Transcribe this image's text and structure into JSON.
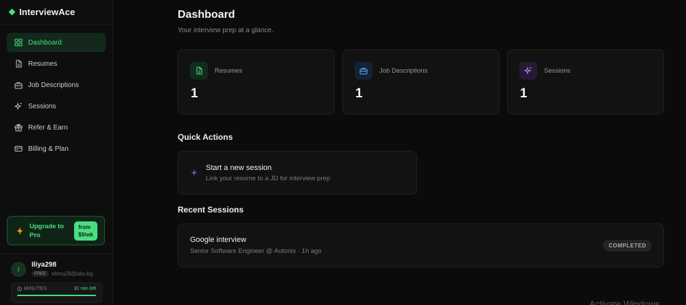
{
  "brand": {
    "name": "InterviewAce"
  },
  "sidebar": {
    "items": [
      {
        "label": "Dashboard",
        "icon": "grid-icon",
        "active": true
      },
      {
        "label": "Resumes",
        "icon": "file-icon"
      },
      {
        "label": "Job Descriptions",
        "icon": "briefcase-icon"
      },
      {
        "label": "Sessions",
        "icon": "sparkles-icon"
      },
      {
        "label": "Refer & Earn",
        "icon": "gift-icon"
      },
      {
        "label": "Billing & Plan",
        "icon": "credit-card-icon"
      }
    ],
    "upgrade": {
      "label": "Upgrade to Pro",
      "price_line1": "from",
      "price_line2": "$9/wk"
    }
  },
  "user": {
    "initial": "I",
    "name": "Iliya298",
    "plan": "FREE",
    "email": "shmu28@abv.bg",
    "minutes_label": "MINUTES",
    "minutes_left": "31 min left",
    "minutes_fraction": 1.0
  },
  "main": {
    "title": "Dashboard",
    "subtitle": "Your interview prep at a glance.",
    "stats": [
      {
        "label": "Resumes",
        "value": "1",
        "icon": "file-icon",
        "color": "#4ade80"
      },
      {
        "label": "Job Descriptions",
        "value": "1",
        "icon": "briefcase-icon",
        "color": "#60a5fa"
      },
      {
        "label": "Sessions",
        "value": "1",
        "icon": "sparkles-icon",
        "color": "#c084fc"
      }
    ],
    "quick_actions_title": "Quick Actions",
    "quick_action": {
      "title": "Start a new session",
      "subtitle": "Link your resume to a JD for interview prep"
    },
    "recent_sessions_title": "Recent Sessions",
    "session": {
      "title": "Google interview",
      "subtitle": "Senior Software Engineer @ Autonix · 1h ago",
      "status": "COMPLETED"
    }
  },
  "watermark": "Activate Windows",
  "colors": {
    "accent": "#4ade80",
    "background": "#0b0b0b"
  }
}
